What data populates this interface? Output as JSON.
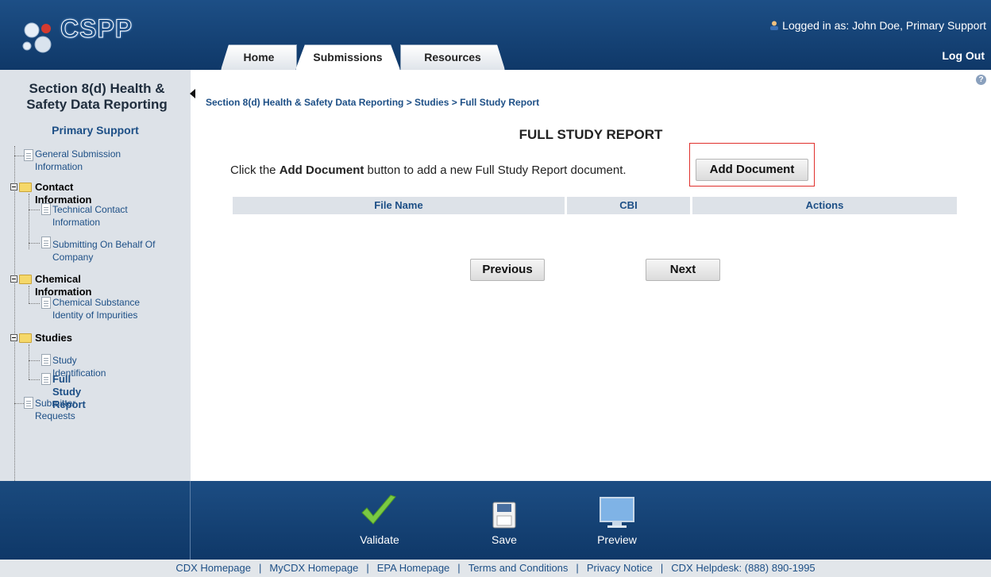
{
  "header": {
    "brand": "CSPP",
    "logged_in_label": "Logged in as:",
    "logged_in_user": "John Doe, Primary Support",
    "logout": "Log Out",
    "tabs": [
      {
        "label": "Home"
      },
      {
        "label": "Submissions",
        "active": true
      },
      {
        "label": "Resources"
      }
    ]
  },
  "sidebar": {
    "title": "Section 8(d) Health & Safety Data Reporting",
    "role": "Primary Support",
    "tree": {
      "general": "General Submission Information",
      "contact_folder": "Contact Information",
      "technical": "Technical Contact Information",
      "behalf": "Submitting On Behalf Of Company",
      "chemical_folder": "Chemical Information",
      "substance": "Chemical Substance Identity of Impurities",
      "studies_folder": "Studies",
      "study_id": "Study Identification",
      "full_report": "Full Study Report",
      "requests": "Submitter Requests"
    }
  },
  "main": {
    "help": "?",
    "breadcrumb": "Section 8(d) Health & Safety Data Reporting > Studies > Full Study Report",
    "title": "FULL STUDY REPORT",
    "instruction_pre": "Click the ",
    "instruction_bold": "Add Document",
    "instruction_post": " button to add a new Full Study Report document.",
    "add_button": "Add Document",
    "table_headers": [
      "File Name",
      "CBI",
      "Actions"
    ],
    "previous": "Previous",
    "next": "Next"
  },
  "footer": {
    "validate": "Validate",
    "save": "Save",
    "preview": "Preview",
    "links": [
      "CDX Homepage",
      "MyCDX Homepage",
      "EPA Homepage",
      "Terms and Conditions",
      "Privacy Notice",
      "CDX Helpdesk: (888) 890-1995"
    ]
  }
}
